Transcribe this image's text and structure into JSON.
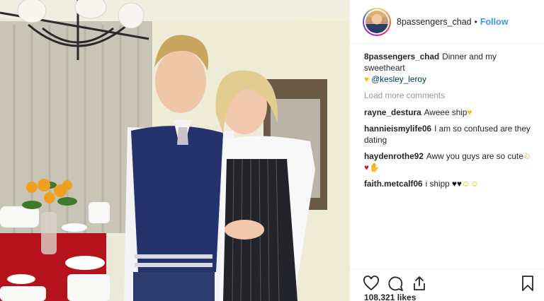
{
  "post": {
    "username": "8passengers_chad",
    "follow_label": "Follow",
    "separator": "•"
  },
  "caption": {
    "username": "8passengers_chad",
    "text": "Dinner and my sweetheart",
    "heart": "♥",
    "mention": "@kesley_leroy"
  },
  "load_more_label": "Load more comments",
  "comments": [
    {
      "username": "rayne_destura",
      "text": "Aweee ship",
      "emoji": "♥"
    },
    {
      "username": "hannieismylife06",
      "text": "I am so confused are they dating",
      "emoji": ""
    },
    {
      "username": "haydenrothe92",
      "text": "Aww you guys are so cute",
      "emoji": "☺",
      "extra": "♥"
    },
    {
      "username": "faith.metcalf06",
      "text": "i shipp",
      "emoji": "♥♥",
      "extra": "☺☺"
    }
  ],
  "likes_text": "108,321 likes",
  "icons": {
    "like": "heart-outline-icon",
    "comment": "comment-bubble-icon",
    "share": "share-icon",
    "save": "bookmark-icon"
  },
  "colors": {
    "follow": "#3897f0",
    "mention": "#003569",
    "muted": "#999999"
  }
}
